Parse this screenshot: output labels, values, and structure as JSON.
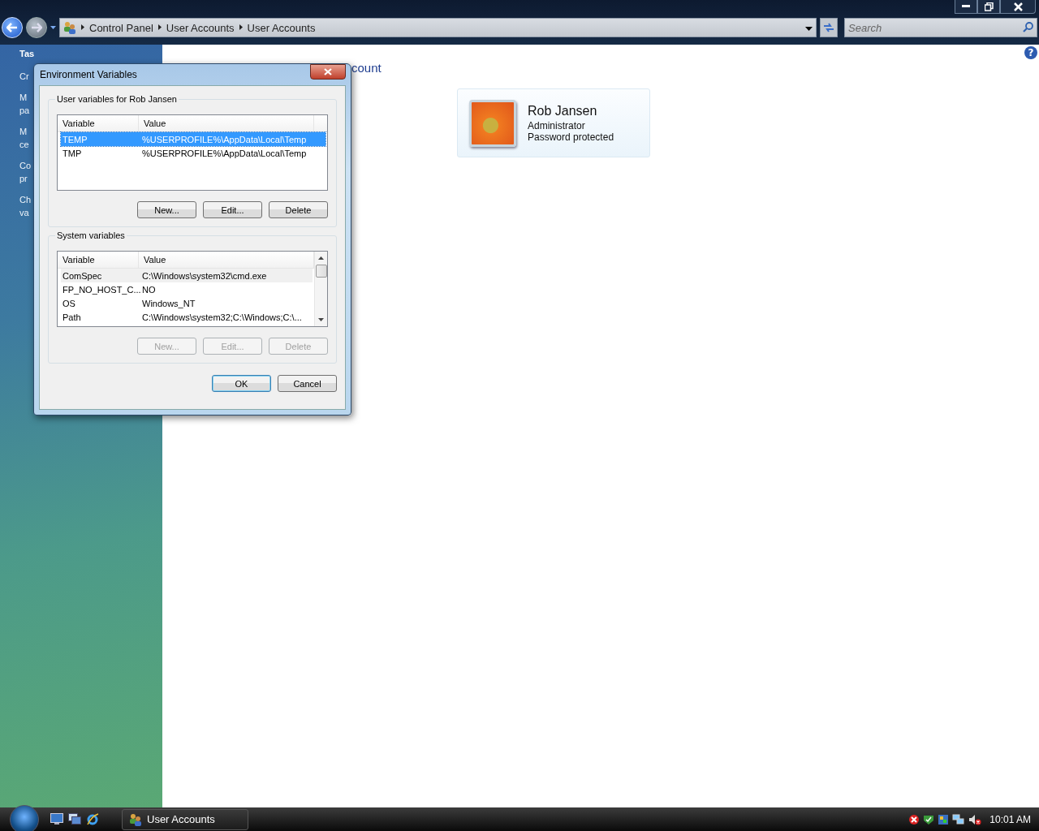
{
  "window": {
    "breadcrumb": [
      "Control Panel",
      "User Accounts",
      "User Accounts"
    ],
    "search": {
      "placeholder": "Search"
    }
  },
  "sidebar": {
    "heading": "Tas",
    "links": [
      [
        "Cr"
      ],
      [
        "M",
        "pa"
      ],
      [
        "M",
        "ce"
      ],
      [
        "Co",
        "pr"
      ],
      [
        "Ch",
        "va"
      ]
    ]
  },
  "content": {
    "heading_fragment": "count",
    "help_glyph": "?",
    "account": {
      "name": "Rob Jansen",
      "role": "Administrator",
      "status": "Password protected"
    }
  },
  "dialog": {
    "title": "Environment Variables",
    "groups": [
      {
        "label": "User variables for Rob Jansen",
        "focused": true,
        "scrollbar": false,
        "columns": [
          "Variable",
          "Value"
        ],
        "rows": [
          {
            "variable": "TEMP",
            "value": "%USERPROFILE%\\AppData\\Local\\Temp",
            "selected": true
          },
          {
            "variable": "TMP",
            "value": "%USERPROFILE%\\AppData\\Local\\Temp",
            "selected": false
          }
        ],
        "buttons": [
          {
            "label": "New...",
            "disabled": false
          },
          {
            "label": "Edit...",
            "disabled": false
          },
          {
            "label": "Delete",
            "disabled": false
          }
        ]
      },
      {
        "label": "System variables",
        "focused": false,
        "scrollbar": true,
        "columns": [
          "Variable",
          "Value"
        ],
        "rows": [
          {
            "variable": "ComSpec",
            "value": "C:\\Windows\\system32\\cmd.exe",
            "selected": true
          },
          {
            "variable": "FP_NO_HOST_C...",
            "value": "NO",
            "selected": false
          },
          {
            "variable": "OS",
            "value": "Windows_NT",
            "selected": false
          },
          {
            "variable": "Path",
            "value": "C:\\Windows\\system32;C:\\Windows;C:\\...",
            "selected": false
          }
        ],
        "buttons": [
          {
            "label": "New...",
            "disabled": true
          },
          {
            "label": "Edit...",
            "disabled": true
          },
          {
            "label": "Delete",
            "disabled": true
          }
        ]
      }
    ],
    "buttons": [
      {
        "label": "OK",
        "default": true
      },
      {
        "label": "Cancel",
        "default": false
      }
    ]
  },
  "taskbar": {
    "tasks": [
      {
        "label": "User Accounts",
        "active": false
      }
    ],
    "clock": "10:01 AM"
  }
}
